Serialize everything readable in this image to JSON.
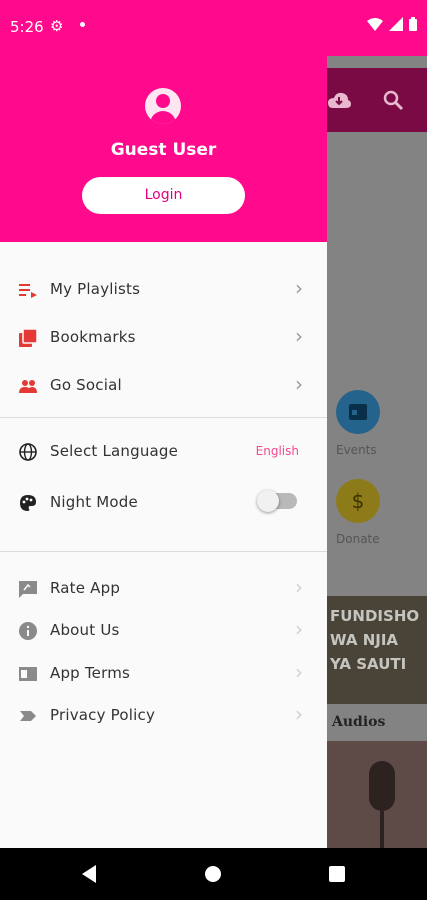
{
  "status_bar": {
    "time": "5:26"
  },
  "profile": {
    "name": "Guest User",
    "login_label": "Login"
  },
  "menu": {
    "group1": [
      {
        "label": "My Playlists",
        "icon": "playlist-icon"
      },
      {
        "label": "Bookmarks",
        "icon": "bookmarks-icon"
      },
      {
        "label": "Go Social",
        "icon": "people-icon"
      }
    ],
    "language": {
      "label": "Select Language",
      "value": "English"
    },
    "night_mode": {
      "label": "Night Mode",
      "enabled": false
    },
    "group2": [
      {
        "label": "Rate App",
        "icon": "rate-icon"
      },
      {
        "label": "About Us",
        "icon": "info-icon"
      },
      {
        "label": "App Terms",
        "icon": "terms-icon"
      },
      {
        "label": "Privacy Policy",
        "icon": "label-icon"
      }
    ]
  },
  "background": {
    "events_label": "Events",
    "donate_label": "Donate",
    "promo_lines": [
      "FUNDISHO",
      "WA NJIA",
      "YA SAUTI"
    ],
    "audios_label": "Audios"
  },
  "colors": {
    "accent": "#ff0a8c",
    "icon_red": "#e53935",
    "grey_icon": "#8a8a8a"
  }
}
